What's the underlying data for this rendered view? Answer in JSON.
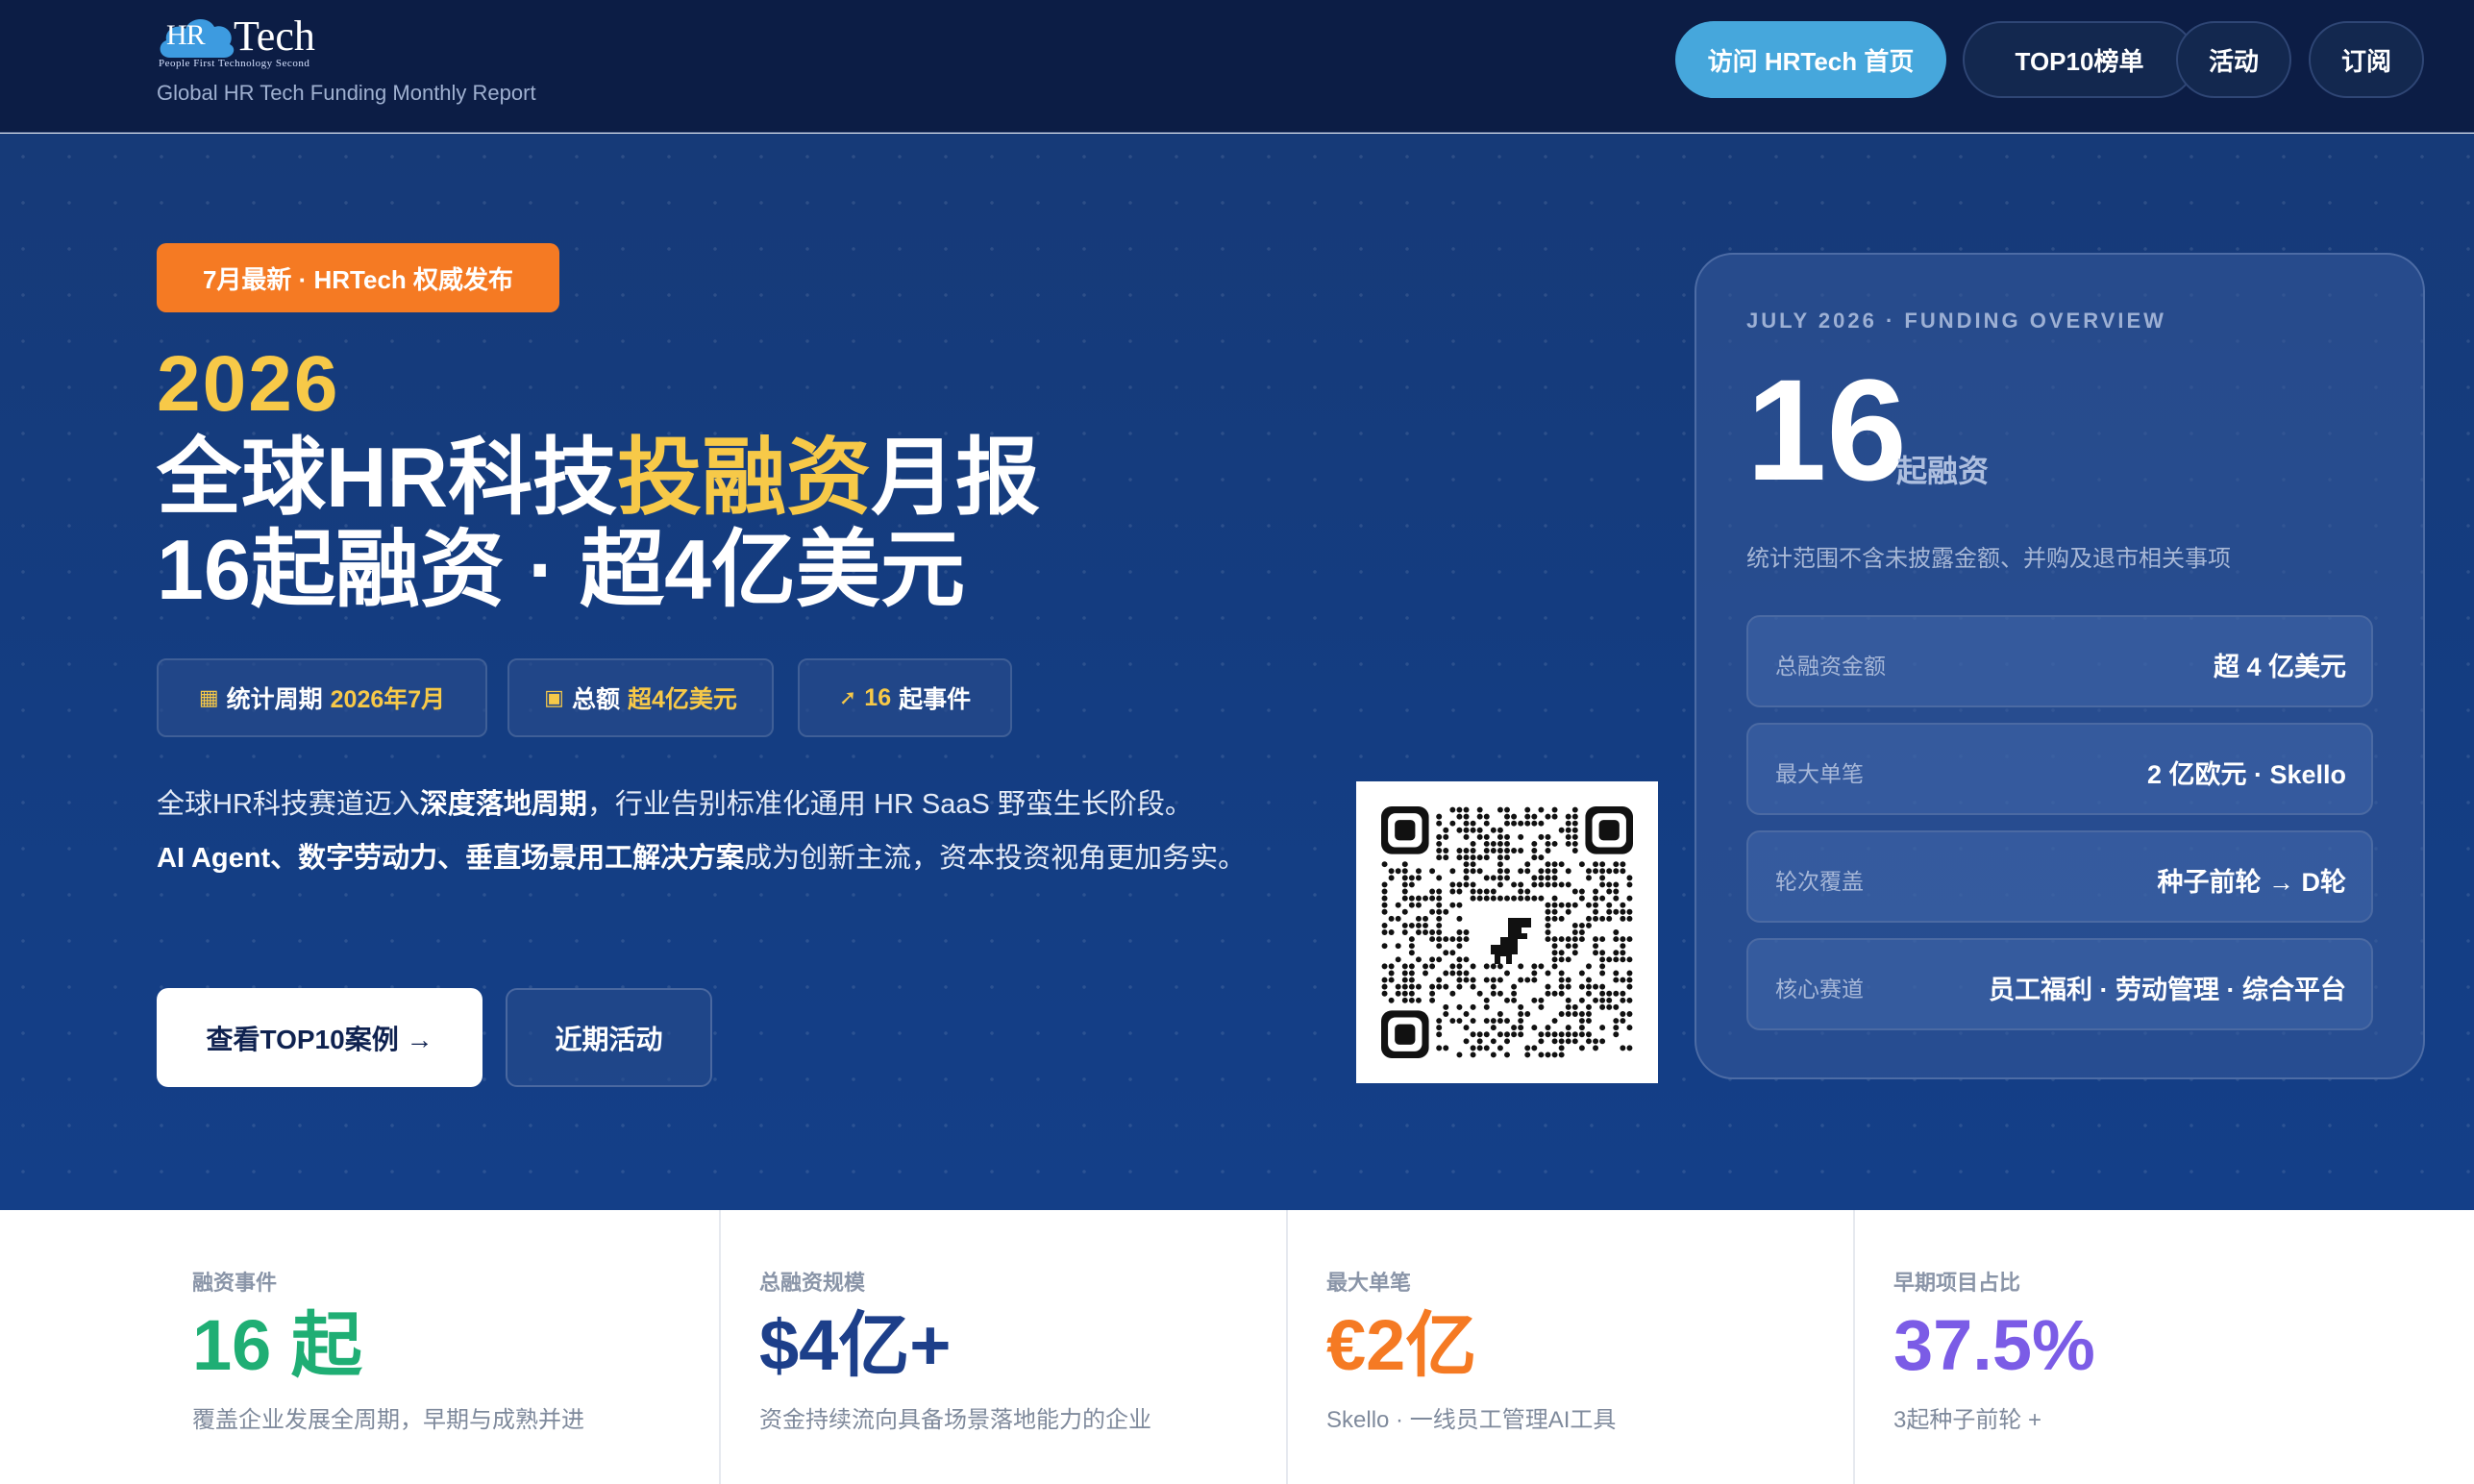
{
  "header": {
    "logo_hr": "HR",
    "logo_tech": "Tech",
    "logo_tagline": "People First  Technology Second",
    "subtitle": "Global HR Tech Funding Monthly Report",
    "nav": [
      "访问 HRTech 首页",
      "TOP10榜单",
      "活动",
      "订阅"
    ]
  },
  "hero": {
    "badge": "7月最新 · HRTech 权威发布",
    "year": "2026",
    "title_line1_a": "全球HR科技",
    "title_line1_b": "投融资",
    "title_line1_c": "月报",
    "title_line2": "16起融资 · 超4亿美元",
    "chips": [
      {
        "icon": "calendar-icon",
        "label": "统计周期",
        "value": "2026年7月"
      },
      {
        "icon": "money-icon",
        "label": "总额",
        "value": "超4亿美元"
      },
      {
        "icon": "rocket-icon",
        "label": "起事件",
        "value": "16"
      }
    ],
    "desc_1": "全球HR科技赛道迈入",
    "desc_2": "深度落地周期",
    "desc_3": "，行业告别标准化通用 HR SaaS 野蛮生长阶段。",
    "desc_4": "AI Agent、数字劳动力、垂直场景用工解决方案",
    "desc_5": "成为创新主流，资本投资视角更加务实。",
    "cta_primary": "查看TOP10案例 →",
    "cta_secondary": "近期活动"
  },
  "overview": {
    "label": "JULY 2026 · FUNDING OVERVIEW",
    "number": "16",
    "unit": "起融资",
    "note": "统计范围不含未披露金额、并购及退市相关事项",
    "rows": [
      {
        "key": "总融资金额",
        "value": "超 4 亿美元"
      },
      {
        "key": "最大单笔",
        "value": "2 亿欧元 · Skello"
      },
      {
        "key": "轮次覆盖",
        "value": "种子前轮 → D轮"
      },
      {
        "key": "核心赛道",
        "value": "员工福利 · 劳动管理 · 综合平台"
      }
    ]
  },
  "stats": [
    {
      "label": "融资事件",
      "value": "16 起",
      "color": "#1fae74",
      "desc": "覆盖企业发展全周期，早期与成熟并进"
    },
    {
      "label": "总融资规模",
      "value": "$4亿+",
      "color": "#1d3f8a",
      "desc": "资金持续流向具备场景落地能力的企业"
    },
    {
      "label": "最大单笔",
      "value": "€2亿",
      "color": "#f57a23",
      "desc": "Skello · 一线员工管理AI工具"
    },
    {
      "label": "早期项目占比",
      "value": "37.5%",
      "color": "#7b5ce6",
      "desc": "3起种子前轮 +"
    }
  ]
}
